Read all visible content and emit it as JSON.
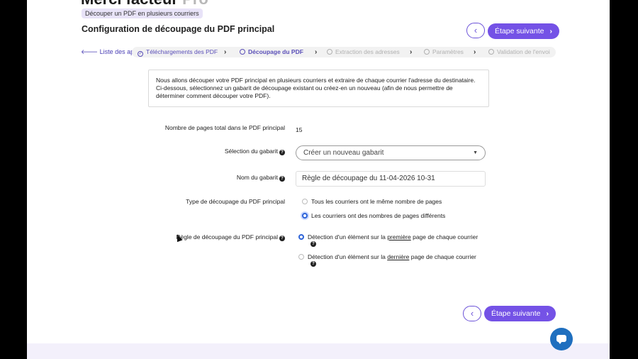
{
  "header": {
    "app_title": "Merci facteur",
    "app_version": "Pro",
    "chip": "Découper un PDF en plusieurs courriers",
    "main_title": "Configuration de découpage du PDF principal",
    "prev_symbol": "‹",
    "next_label": "Étape suivante",
    "next_chevron": "›"
  },
  "breadcrumb": {
    "back_label": "Liste des apps",
    "back_icon": "arrow-left-icon",
    "separator": "›",
    "steps": [
      {
        "label": "Téléchargements des PDF",
        "state": "done",
        "icon": "check-circle-icon"
      },
      {
        "label": "Découpage du PDF",
        "state": "active",
        "icon": "circle-icon"
      },
      {
        "label": "Extraction des adresses",
        "state": "todo",
        "icon": "circle-icon"
      },
      {
        "label": "Paramètres",
        "state": "todo",
        "icon": "circle-icon"
      },
      {
        "label": "Validation de l'envoi",
        "state": "todo",
        "icon": "circle-icon"
      }
    ]
  },
  "info": {
    "text": "Nous allons découper votre PDF principal en plusieurs courriers et extraire de chaque courrier l'adresse du destinataire. Ci-dessous, sélectionnez un gabarit de découpage existant ou créez-en un nouveau (afin de nous permettre de déterminer comment découper votre PDF)."
  },
  "form": {
    "total_pages_label": "Nombre de pages total dans le PDF principal",
    "total_pages_value": "15",
    "template_label": "Sélection du gabarit",
    "template_value": "Créer un nouveau gabarit",
    "name_label": "Nom du gabarit",
    "name_value": "Règle de découpage du 11-04-2026 10-31",
    "type_label": "Type de découpage du PDF principal",
    "type_options": [
      {
        "label": "Tous les courriers ont le même nombre de pages",
        "selected": false
      },
      {
        "label": "Les courriers ont des nombres de pages différents",
        "selected": true
      }
    ],
    "rule_label": "Règle de découpage du PDF principal",
    "rule_options": [
      {
        "prefix": "Détection d'un élément sur la ",
        "emph": "première",
        "suffix": " page de chaque courrier",
        "selected": true
      },
      {
        "prefix": "Détection d'un élément sur la ",
        "emph": "dernière",
        "suffix": " page de chaque courrier",
        "selected": false
      }
    ],
    "help_symbol": "?"
  },
  "footer": {
    "prev_symbol": "‹",
    "next_label": "Étape suivante",
    "next_chevron": "›"
  },
  "colors": {
    "accent": "#7452e6",
    "link": "#4a3fb5",
    "radio_selected": "#2d63d8",
    "chat": "#1f6fbf"
  }
}
